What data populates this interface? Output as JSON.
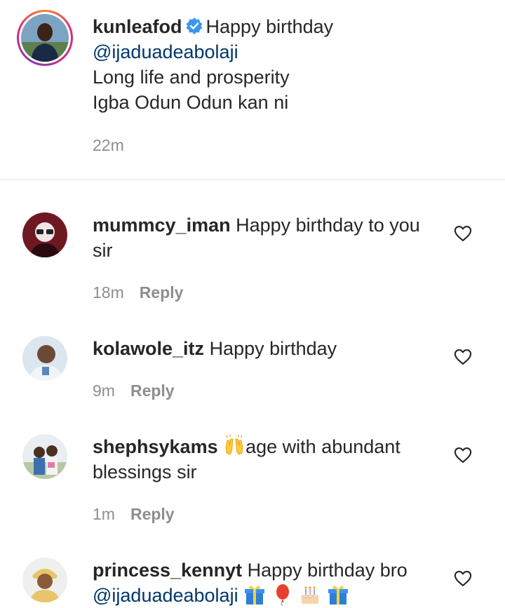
{
  "comments": [
    {
      "username": "kunleafod",
      "verified": true,
      "text_line1": "Happy birthday",
      "mention": "@ijaduadeabolaji",
      "text_line3": "Long life and prosperity",
      "text_line4": "Igba Odun Odun kan ni",
      "time": "22m"
    },
    {
      "username": "mummcy_iman",
      "text": "Happy birthday to you",
      "text_cont": "sir",
      "time": "18m",
      "reply_label": "Reply"
    },
    {
      "username": "kolawole_itz",
      "text": "Happy birthday",
      "time": "9m",
      "reply_label": "Reply"
    },
    {
      "username": "shephsykams",
      "emoji": "raising-hands",
      "text": "age with abundant",
      "text_cont": "blessings sir",
      "time": "1m",
      "reply_label": "Reply"
    },
    {
      "username": "princess_kennyt",
      "text": "Happy birthday bro",
      "mention": "@ijaduadeabolaji",
      "emojis": [
        "gift",
        "balloon",
        "birthday-cake",
        "gift"
      ]
    }
  ],
  "icons": {
    "like": "heart-outline-icon",
    "verified": "verified-badge-icon"
  },
  "colors": {
    "mention": "#00376b",
    "verified": "#3897f0",
    "meta": "#8e8e8e"
  }
}
